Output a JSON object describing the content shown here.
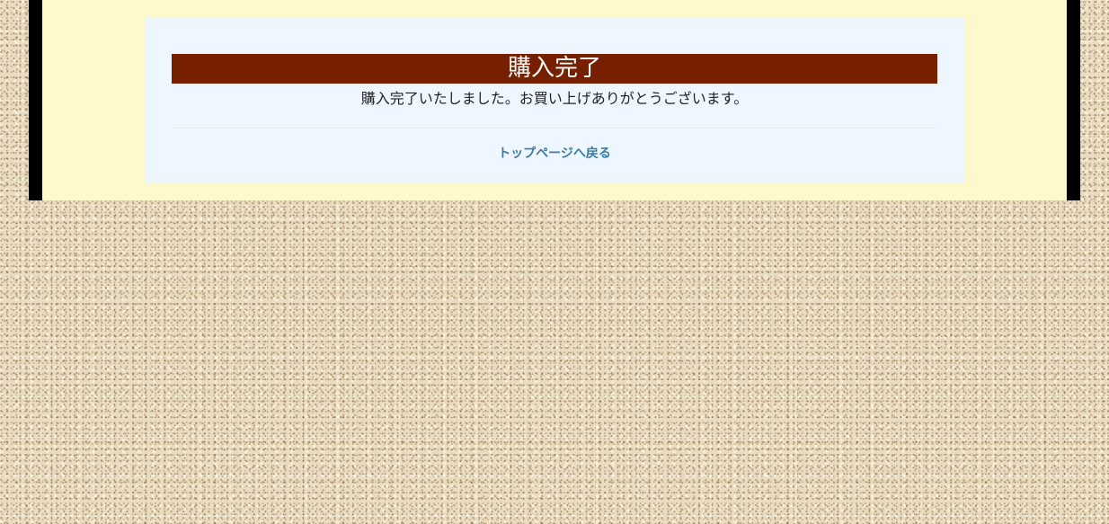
{
  "page": {
    "title": "購入完了",
    "message": "購入完了いたしました。お買い上げありがとうございます。",
    "back_link_label": "トップページへ戻る"
  },
  "colors": {
    "title_bar": "#762000",
    "title_text": "#ffffff",
    "panel_bg": "#eef7ff",
    "frame_inner_bg": "#fef8cd",
    "frame_border": "#000000",
    "link": "#3a7aa3"
  }
}
